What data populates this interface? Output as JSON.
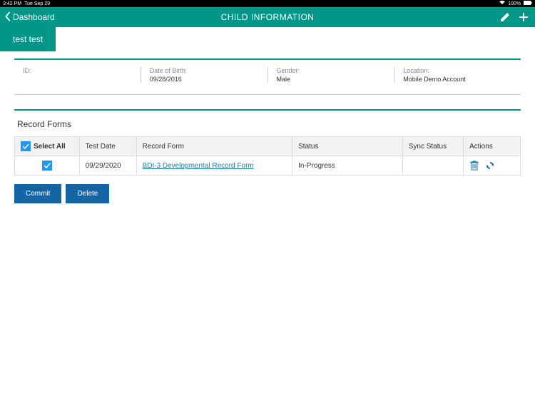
{
  "status_bar": {
    "time": "3:42 PM",
    "date": "Tue Sep 29",
    "battery": "100%"
  },
  "nav": {
    "back_label": "Dashboard",
    "title": "CHILD INFORMATION"
  },
  "tab": {
    "active_label": "test test"
  },
  "info": {
    "id_label": "ID:",
    "id_value": "",
    "dob_label": "Date of Birth:",
    "dob_value": "09/28/2016",
    "gender_label": "Gender:",
    "gender_value": "Male",
    "location_label": "Location:",
    "location_value": "Mobile Demo Account"
  },
  "records": {
    "section_title": "Record Forms",
    "headers": {
      "select_all": "Select All",
      "test_date": "Test Date",
      "record_form": "Record Form",
      "status": "Status",
      "sync_status": "Sync Status",
      "actions": "Actions"
    },
    "rows": [
      {
        "test_date": "09/29/2020",
        "record_form": "BDI-3 Developmental Record Form",
        "status": "In-Progress",
        "sync_status": ""
      }
    ]
  },
  "buttons": {
    "commit": "Commit",
    "delete": "Delete"
  }
}
